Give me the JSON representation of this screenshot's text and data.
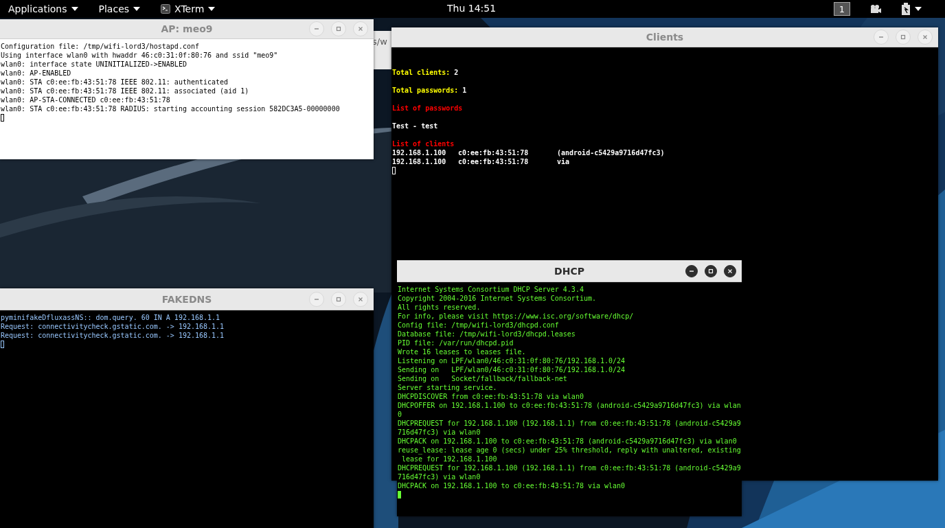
{
  "top_bar": {
    "menus": [
      {
        "label": "Applications",
        "kind": "menu"
      },
      {
        "label": "Places",
        "kind": "menu"
      },
      {
        "label": "XTerm",
        "kind": "app"
      }
    ],
    "clock": "Thu 14:51",
    "workspace": "1"
  },
  "background_window": {
    "text": "s/w"
  },
  "windows": [
    {
      "title": "AP: meo9",
      "kind": "log",
      "dark": false,
      "color": "#000000",
      "focused": false,
      "lines": [
        "Configuration file: /tmp/wifi-lord3/hostapd.conf",
        "Using interface wlan0 with hwaddr 46:c0:31:0f:80:76 and ssid \"meo9\"",
        "wlan0: interface state UNINITIALIZED->ENABLED",
        "wlan0: AP-ENABLED",
        "wlan0: STA c0:ee:fb:43:51:78 IEEE 802.11: authenticated",
        "wlan0: STA c0:ee:fb:43:51:78 IEEE 802.11: associated (aid 1)",
        "wlan0: AP-STA-CONNECTED c0:ee:fb:43:51:78",
        "wlan0: STA c0:ee:fb:43:51:78 RADIUS: starting accounting session 582DC3A5-00000000"
      ]
    },
    {
      "title": "Clients",
      "kind": "report",
      "dark": true,
      "color": "#ffffff",
      "focused": false,
      "entries": [
        {
          "kind": "stat",
          "label": "Total clients:",
          "value": "2"
        },
        {
          "kind": "stat",
          "label": "Total passwords:",
          "value": "1"
        },
        {
          "kind": "heading",
          "text": "List of passwords"
        },
        {
          "kind": "entry",
          "text": "Test - test"
        },
        {
          "kind": "heading",
          "text": "List of clients"
        },
        {
          "kind": "row",
          "ip": "192.168.1.100",
          "mac": "c0:ee:fb:43:51:78",
          "name": "(android-c5429a9716d47fc3)"
        },
        {
          "kind": "row",
          "ip": "192.168.1.100",
          "mac": "c0:ee:fb:43:51:78",
          "name": "via"
        }
      ]
    },
    {
      "title": "FAKEDNS",
      "kind": "log",
      "dark": true,
      "color": "#99c8ff",
      "focused": false,
      "lines": [
        "pyminifakeDfluxassNS:: dom.query. 60 IN A 192.168.1.1",
        "Request: connectivitycheck.gstatic.com. -> 192.168.1.1",
        "Request: connectivitycheck.gstatic.com. -> 192.168.1.1"
      ]
    },
    {
      "title": "DHCP",
      "kind": "log",
      "dark": true,
      "color": "#66ff33",
      "focused": true,
      "lines": [
        "Internet Systems Consortium DHCP Server 4.3.4",
        "Copyright 2004-2016 Internet Systems Consortium.",
        "All rights reserved.",
        "For info, please visit https://www.isc.org/software/dhcp/",
        "Config file: /tmp/wifi-lord3/dhcpd.conf",
        "Database file: /tmp/wifi-lord3/dhcpd.leases",
        "PID file: /var/run/dhcpd.pid",
        "Wrote 16 leases to leases file.",
        "Listening on LPF/wlan0/46:c0:31:0f:80:76/192.168.1.0/24",
        "Sending on   LPF/wlan0/46:c0:31:0f:80:76/192.168.1.0/24",
        "Sending on   Socket/fallback/fallback-net",
        "Server starting service.",
        "DHCPDISCOVER from c0:ee:fb:43:51:78 via wlan0",
        "DHCPOFFER on 192.168.1.100 to c0:ee:fb:43:51:78 (android-c5429a9716d47fc3) via wlan",
        "0",
        "DHCPREQUEST for 192.168.1.100 (192.168.1.1) from c0:ee:fb:43:51:78 (android-c5429a9",
        "716d47fc3) via wlan0",
        "DHCPACK on 192.168.1.100 to c0:ee:fb:43:51:78 (android-c5429a9716d47fc3) via wlan0",
        "reuse_lease: lease age 0 (secs) under 25% threshold, reply with unaltered, existing",
        " lease for 192.168.1.100",
        "DHCPREQUEST for 192.168.1.100 (192.168.1.1) from c0:ee:fb:43:51:78 (android-c5429a9",
        "716d47fc3) via wlan0",
        "DHCPACK on 192.168.1.100 to c0:ee:fb:43:51:78 via wlan0"
      ]
    }
  ]
}
